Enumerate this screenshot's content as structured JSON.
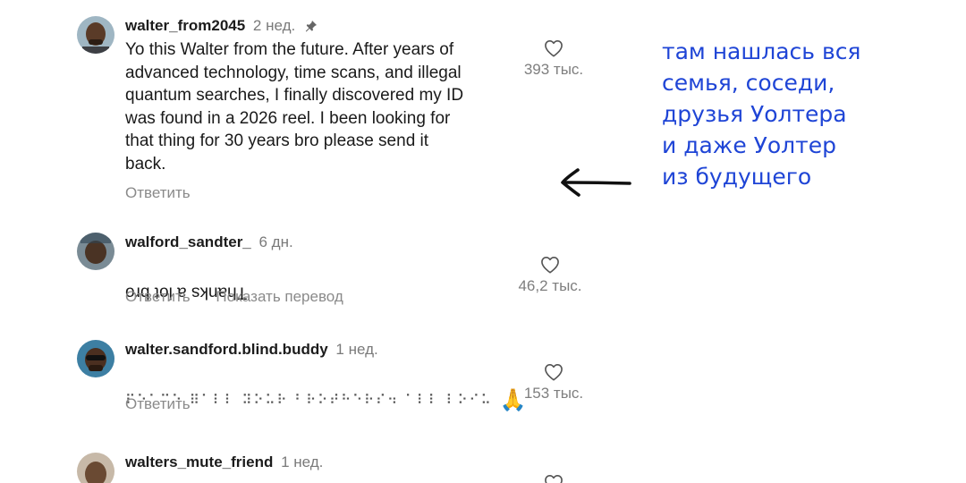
{
  "comments": [
    {
      "username": "walter_from2045",
      "time": "2 нед.",
      "pinned": true,
      "text": "Yo this Walter from the future. After years of\nadvanced technology, time scans, and illegal\nquantum searches, I finally discovered my ID\nwas found in a 2026 reel. I been looking for\nthat thing for 30 years bro please send it\nback.",
      "reply_label": "Ответить",
      "likes": "393 тыс."
    },
    {
      "username": "walford_sandter_",
      "time": "6 дн.",
      "text": "Thanks a lot bro",
      "text_upside_down": true,
      "reply_label": "Ответить",
      "translate_label": "Показать перевод",
      "likes": "46,2 тыс."
    },
    {
      "username": "walter.sandford.blind.buddy",
      "time": "1 нед.",
      "text": "⠏⠑⠁⠉⠑ ⠿⠁⠇⠇ ⠽⠕⠥⠗ ⠃⠗⠕⠞⠓⠑⠗⠎⠲ ⠁⠇⠇ ⠇⠕⠊⠥",
      "emoji": "🙏",
      "reply_label": "Ответить",
      "likes": "153 тыс."
    },
    {
      "username": "walters_mute_friend",
      "time": "1 нед."
    }
  ],
  "annotation": {
    "text": "там нашлась вся\nсемья, соседи,\nдрузья Уолтера\nи даже Уолтер\nиз будущего",
    "color": "#1f45d6"
  },
  "icons": {
    "pin": "pin-icon",
    "heart": "heart-outline-icon",
    "arrow": "hand-drawn-left-arrow"
  }
}
